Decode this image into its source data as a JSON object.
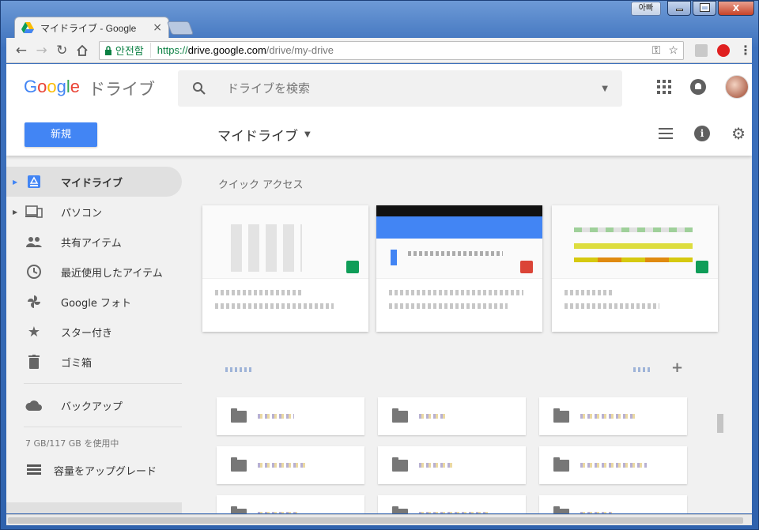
{
  "window": {
    "user_chip": "아빠",
    "close_label": "X"
  },
  "browser": {
    "tab_title": "マイドライブ - Google",
    "tab_close": "×",
    "secure_label": "안전함",
    "url_scheme": "https://",
    "url_host": "drive.google.com",
    "url_path": "/drive/my-drive"
  },
  "header": {
    "logo": "Google",
    "product": "ドライブ",
    "search_placeholder": "ドライブを検索",
    "new_button": "新規",
    "breadcrumb": "マイドライブ"
  },
  "sidebar": {
    "items": [
      {
        "label": "マイドライブ",
        "icon": "drive-icon",
        "active": true,
        "expandable": true
      },
      {
        "label": "パソコン",
        "icon": "computers-icon",
        "active": false,
        "expandable": true
      },
      {
        "label": "共有アイテム",
        "icon": "people-icon",
        "active": false
      },
      {
        "label": "最近使用したアイテム",
        "icon": "clock-icon",
        "active": false
      },
      {
        "label": "Google フォト",
        "icon": "pinwheel-icon",
        "active": false
      },
      {
        "label": "スター付き",
        "icon": "star-icon",
        "active": false
      },
      {
        "label": "ゴミ箱",
        "icon": "trash-icon",
        "active": false
      }
    ],
    "backup_label": "バックアップ",
    "storage_text": "7 GB/117 GB を使用中",
    "upgrade_label": "容量をアップグレード"
  },
  "main": {
    "quick_access_title": "クイック アクセス"
  },
  "colors": {
    "accent": "#4285f4",
    "secure_green": "#0b8043"
  }
}
